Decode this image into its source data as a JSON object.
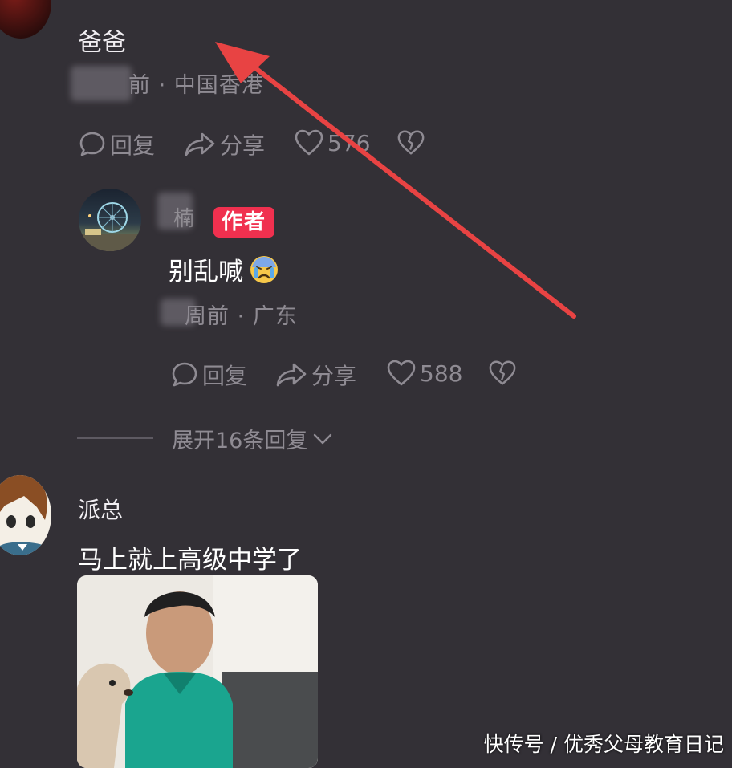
{
  "comment1": {
    "username": "爸爸",
    "meta_suffix": "前 · 中国香港",
    "actions": {
      "reply": "回复",
      "share": "分享",
      "likes": "576"
    }
  },
  "reply1": {
    "username": "楠",
    "badge": "作者",
    "text": "别乱喊",
    "meta": "周前 · 广东",
    "actions": {
      "reply": "回复",
      "share": "分享",
      "likes": "588"
    }
  },
  "expand_replies": "展开16条回复",
  "comment2": {
    "username": "派总",
    "text": "马上就上高级中学了"
  },
  "watermark": "快传号 / 优秀父母教育日记",
  "colors": {
    "background": "#333036",
    "badge": "#f0304f",
    "arrow": "#e84343",
    "muted": "#8f8b93"
  }
}
